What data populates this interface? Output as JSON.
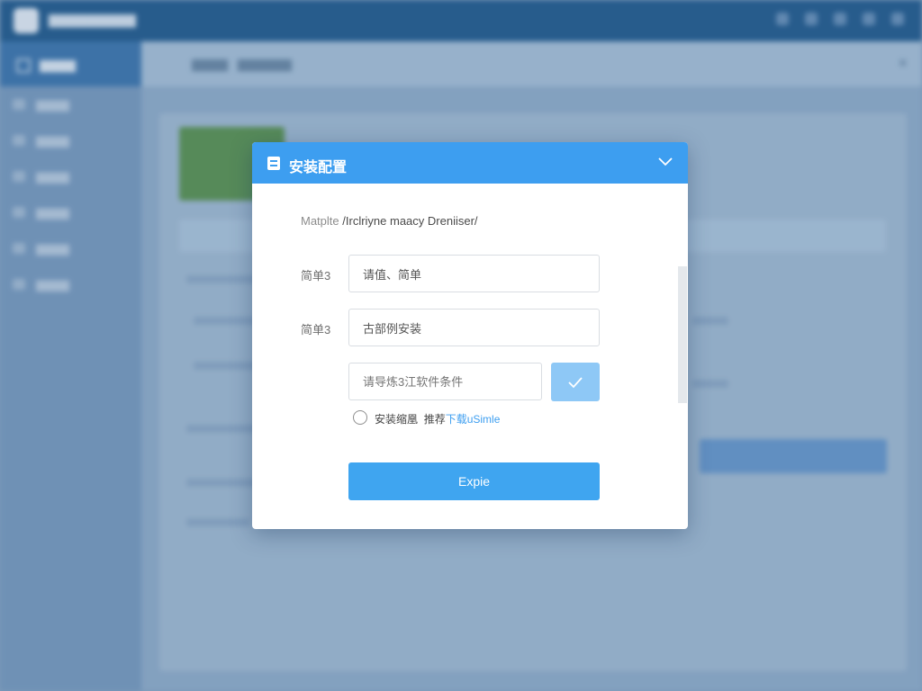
{
  "modal": {
    "title": "安装配置",
    "collapse_icon": "chevron-down-icon",
    "title_icon": "document-icon",
    "subtitle_main": "Matplte",
    "subtitle_rest": "/Irclriyne maacy Dreniiser/",
    "field1": {
      "label": "简单3",
      "value": "请值、简单"
    },
    "field2": {
      "label": "简单3",
      "value": "古部例安装"
    },
    "field3": {
      "placeholder": "请导炼3江软件条件"
    },
    "confirm_icon": "check-icon",
    "radio": {
      "label": "安装缩凰",
      "middle": "推荐",
      "link": "下载uSimle"
    },
    "submit_label": "Expie"
  },
  "colors": {
    "header": "#3d9ef0",
    "submit": "#3fa5f0",
    "confirm": "#8ec8f6",
    "link": "#3d9ef0"
  }
}
